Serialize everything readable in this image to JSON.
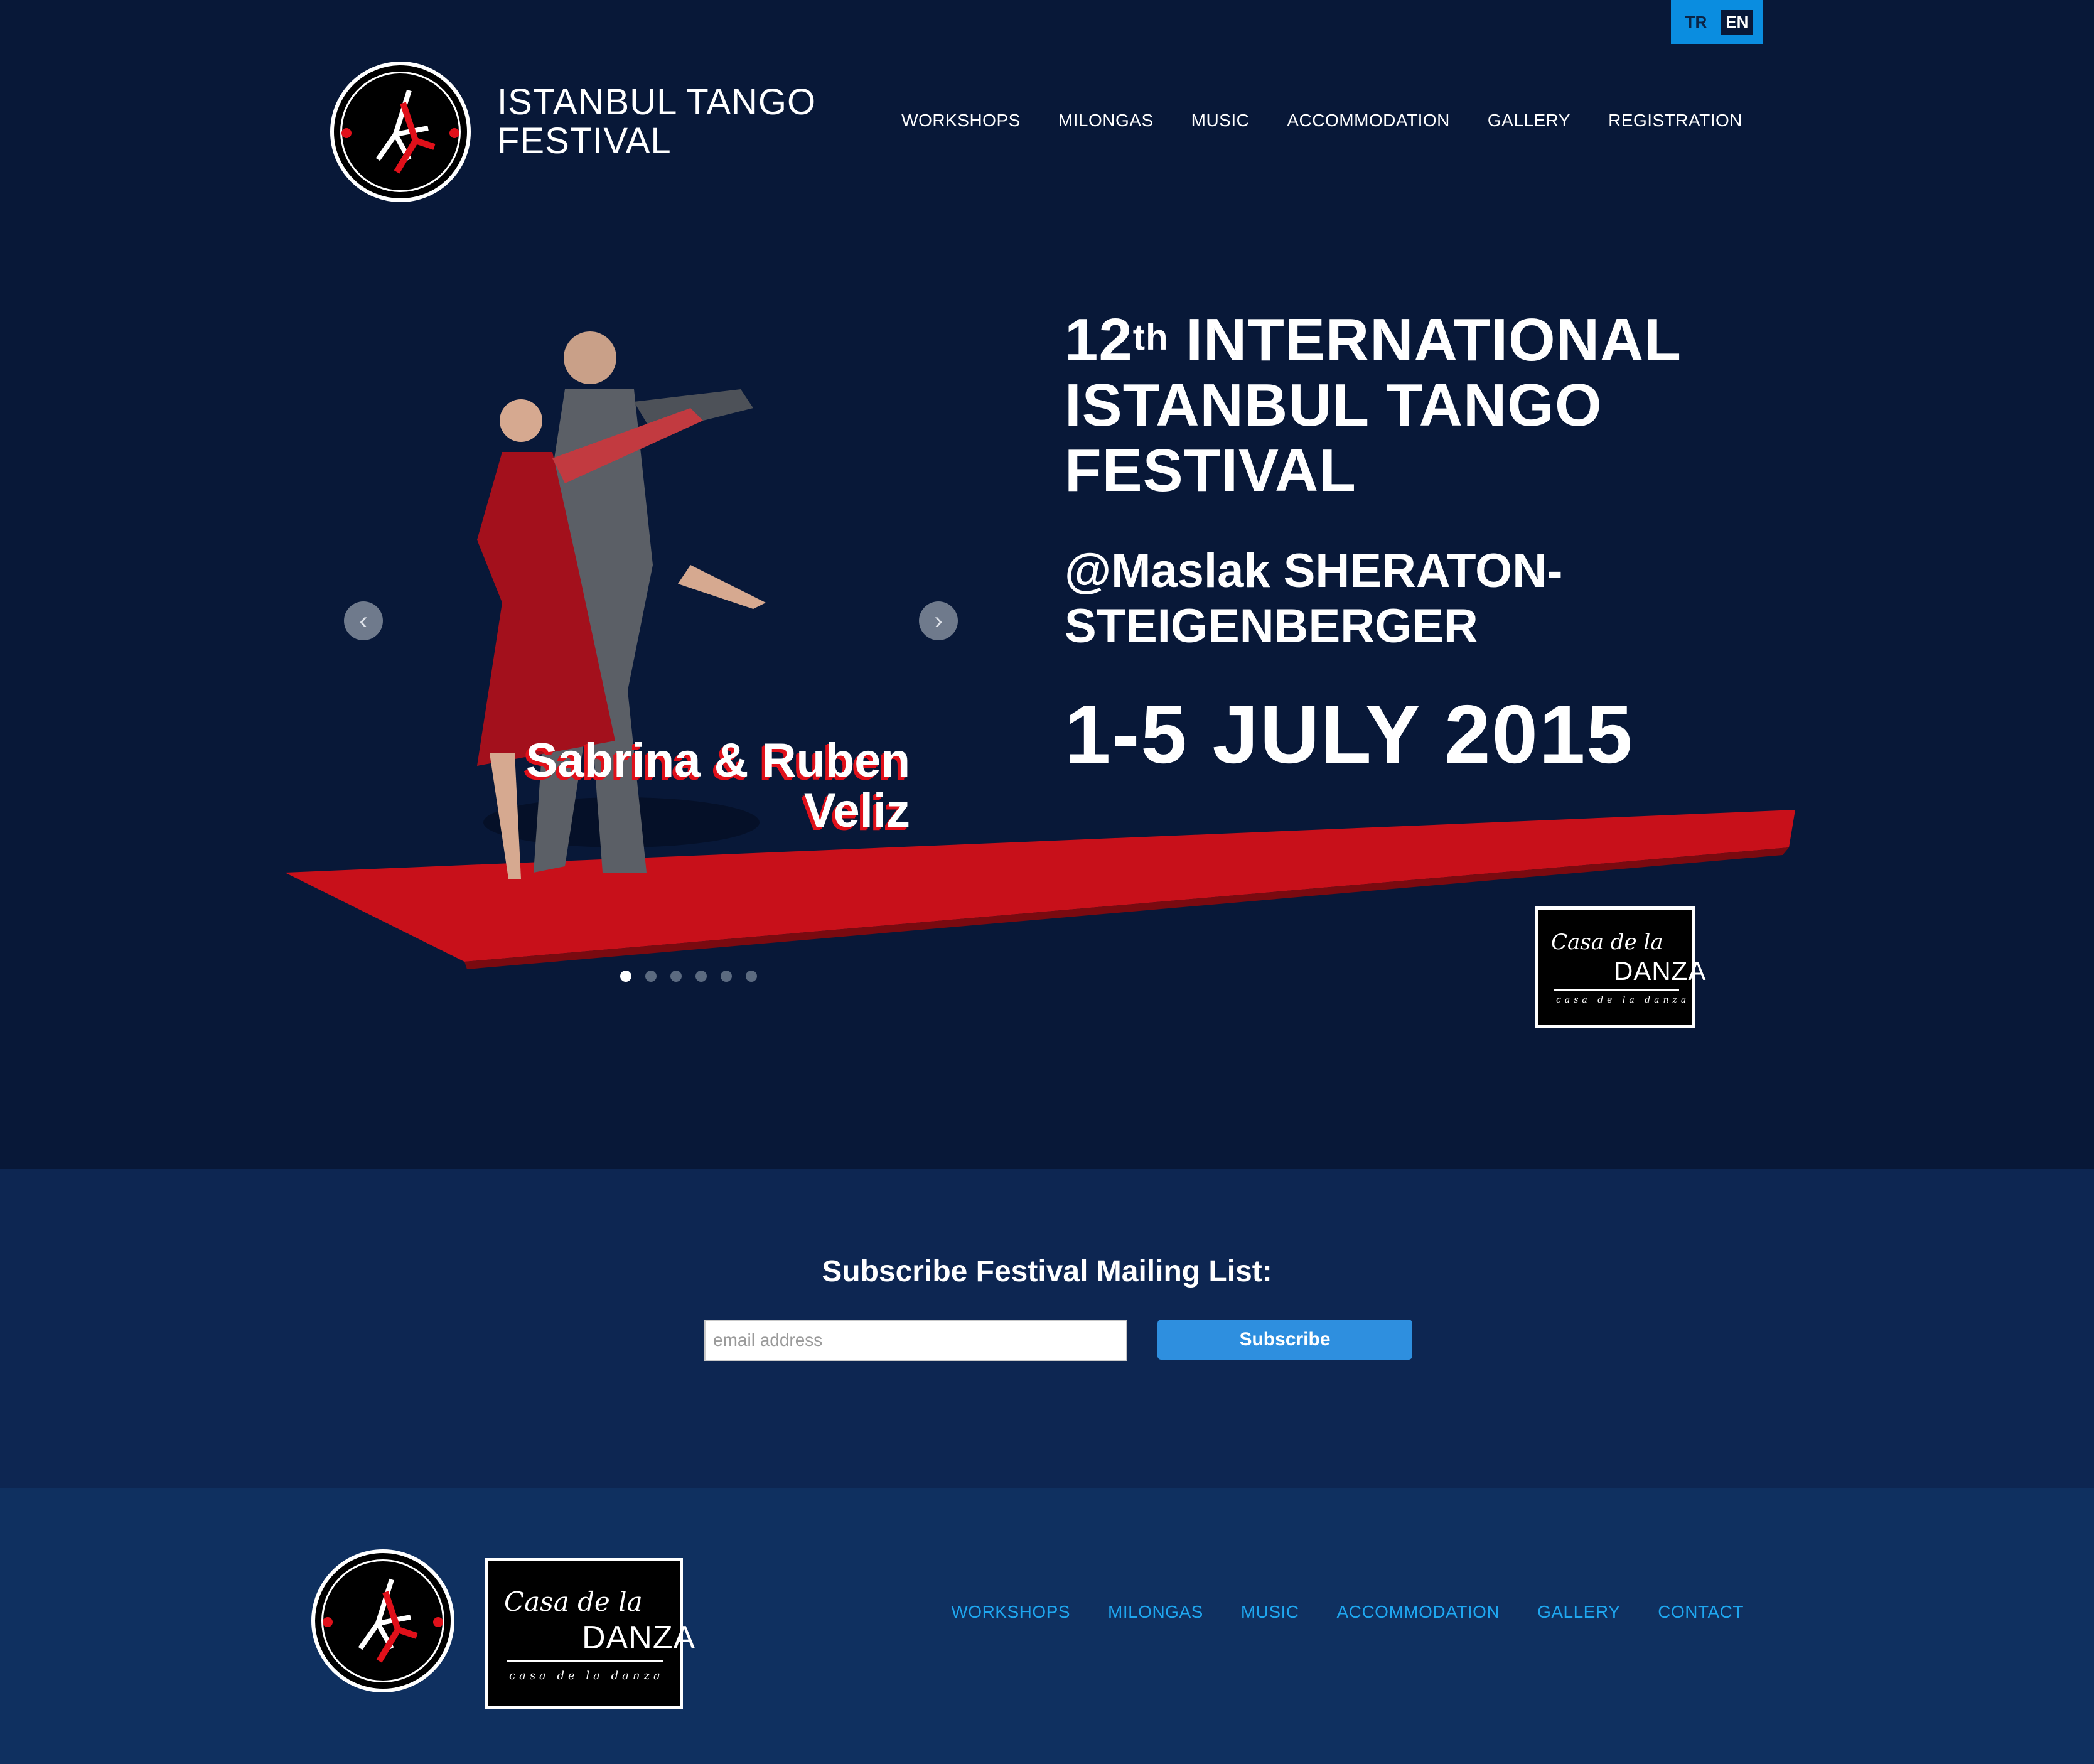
{
  "language_switch": {
    "tr": "TR",
    "en": "EN",
    "active": "EN"
  },
  "header": {
    "title_line1": "ISTANBUL TANGO",
    "title_line2": "FESTIVAL",
    "logo_icon": "festival-badge-icon",
    "nav": [
      "WORKSHOPS",
      "MILONGAS",
      "MUSIC",
      "ACCOMMODATION",
      "GALLERY",
      "REGISTRATION"
    ]
  },
  "hero": {
    "ordinal_number": "12",
    "ordinal_suffix": "th",
    "heading_line1_rest": "INTERNATIONAL",
    "heading_line2": "ISTANBUL TANGO",
    "heading_line3": "FESTIVAL",
    "venue_line1": "@Maslak SHERATON-",
    "venue_line2": "STEIGENBERGER",
    "date": "1-5 JULY 2015",
    "slide_caption_line1": "Sabrina & Ruben",
    "slide_caption_line2": "Veliz",
    "prev_icon": "chevron-left-icon",
    "next_icon": "chevron-right-icon",
    "slide_count": 6,
    "active_slide": 1,
    "sponsor_logo": {
      "script": "Casa de la",
      "brand": "DANZA",
      "tagline": "casa de la danza"
    }
  },
  "subscribe": {
    "title": "Subscribe Festival Mailing List:",
    "email_placeholder": "email address",
    "button_label": "Subscribe"
  },
  "footer": {
    "nav": [
      "WORKSHOPS",
      "MILONGAS",
      "MUSIC",
      "ACCOMMODATION",
      "GALLERY",
      "CONTACT"
    ]
  },
  "colors": {
    "background": "#081838",
    "subscribe_band": "#0d2652",
    "footer": "#0f3060",
    "accent_blue": "#0a8de0",
    "footer_link": "#1fa7f0",
    "carpet_red": "#c8101a"
  }
}
